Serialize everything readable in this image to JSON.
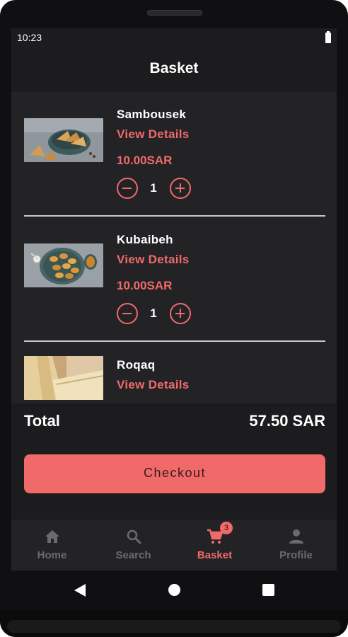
{
  "status_bar": {
    "time": "10:23"
  },
  "header": {
    "title": "Basket"
  },
  "items": [
    {
      "name": "Sambousek",
      "details_label": "View Details",
      "price": "10.00SAR",
      "quantity": "1"
    },
    {
      "name": "Kubaibeh",
      "details_label": "View Details",
      "price": "10.00SAR",
      "quantity": "1"
    },
    {
      "name": "Roqaq",
      "details_label": "View Details"
    }
  ],
  "total": {
    "label": "Total",
    "value": "57.50 SAR"
  },
  "checkout": {
    "label": "Checkout"
  },
  "tab_bar": {
    "tabs": [
      {
        "label": "Home",
        "icon": "home-icon"
      },
      {
        "label": "Search",
        "icon": "search-icon"
      },
      {
        "label": "Basket",
        "icon": "cart-icon",
        "badge": "3",
        "active": true
      },
      {
        "label": "Profile",
        "icon": "person-icon"
      }
    ]
  },
  "colors": {
    "accent": "#f06a6a",
    "background": "#1c1c1e",
    "surface": "#232326",
    "inactive": "#6b6b6e"
  }
}
